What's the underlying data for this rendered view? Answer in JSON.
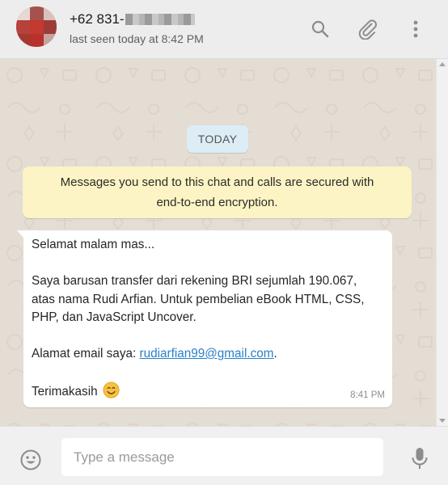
{
  "header": {
    "contact_name_prefix": "+62 831-",
    "last_seen": "last seen today at 8:42 PM",
    "icons": [
      "search-icon",
      "attach-icon",
      "menu-icon"
    ]
  },
  "chat": {
    "date_label": "TODAY",
    "encryption_notice": {
      "line1": "Messages you send to this chat and calls are secured with",
      "line2": "end-to-end encryption."
    },
    "message": {
      "greeting": "Selamat malam mas...",
      "body_line1": "Saya barusan transfer dari rekening BRI sejumlah 190.067,",
      "body_line2": "atas nama Rudi Arfian. Untuk pembelian eBook HTML, CSS,",
      "body_line3": "PHP, dan JavaScript Uncover.",
      "email_label": "Alamat email saya: ",
      "email": "rudiarfian99@gmail.com",
      "email_suffix": ".",
      "closing": "Terimakasih",
      "emoji": "smiling-face-emoji",
      "time": "8:41 PM"
    }
  },
  "footer": {
    "input_placeholder": "Type a message",
    "input_value": "",
    "icons": [
      "emoji-icon",
      "mic-icon"
    ]
  },
  "colors": {
    "chat_background": "#e4ddd4",
    "encryption_notice_bg": "#fcf4c4",
    "date_pill_bg": "#dcedf6",
    "link": "#2980c9",
    "icon": "#8c8c8c"
  }
}
